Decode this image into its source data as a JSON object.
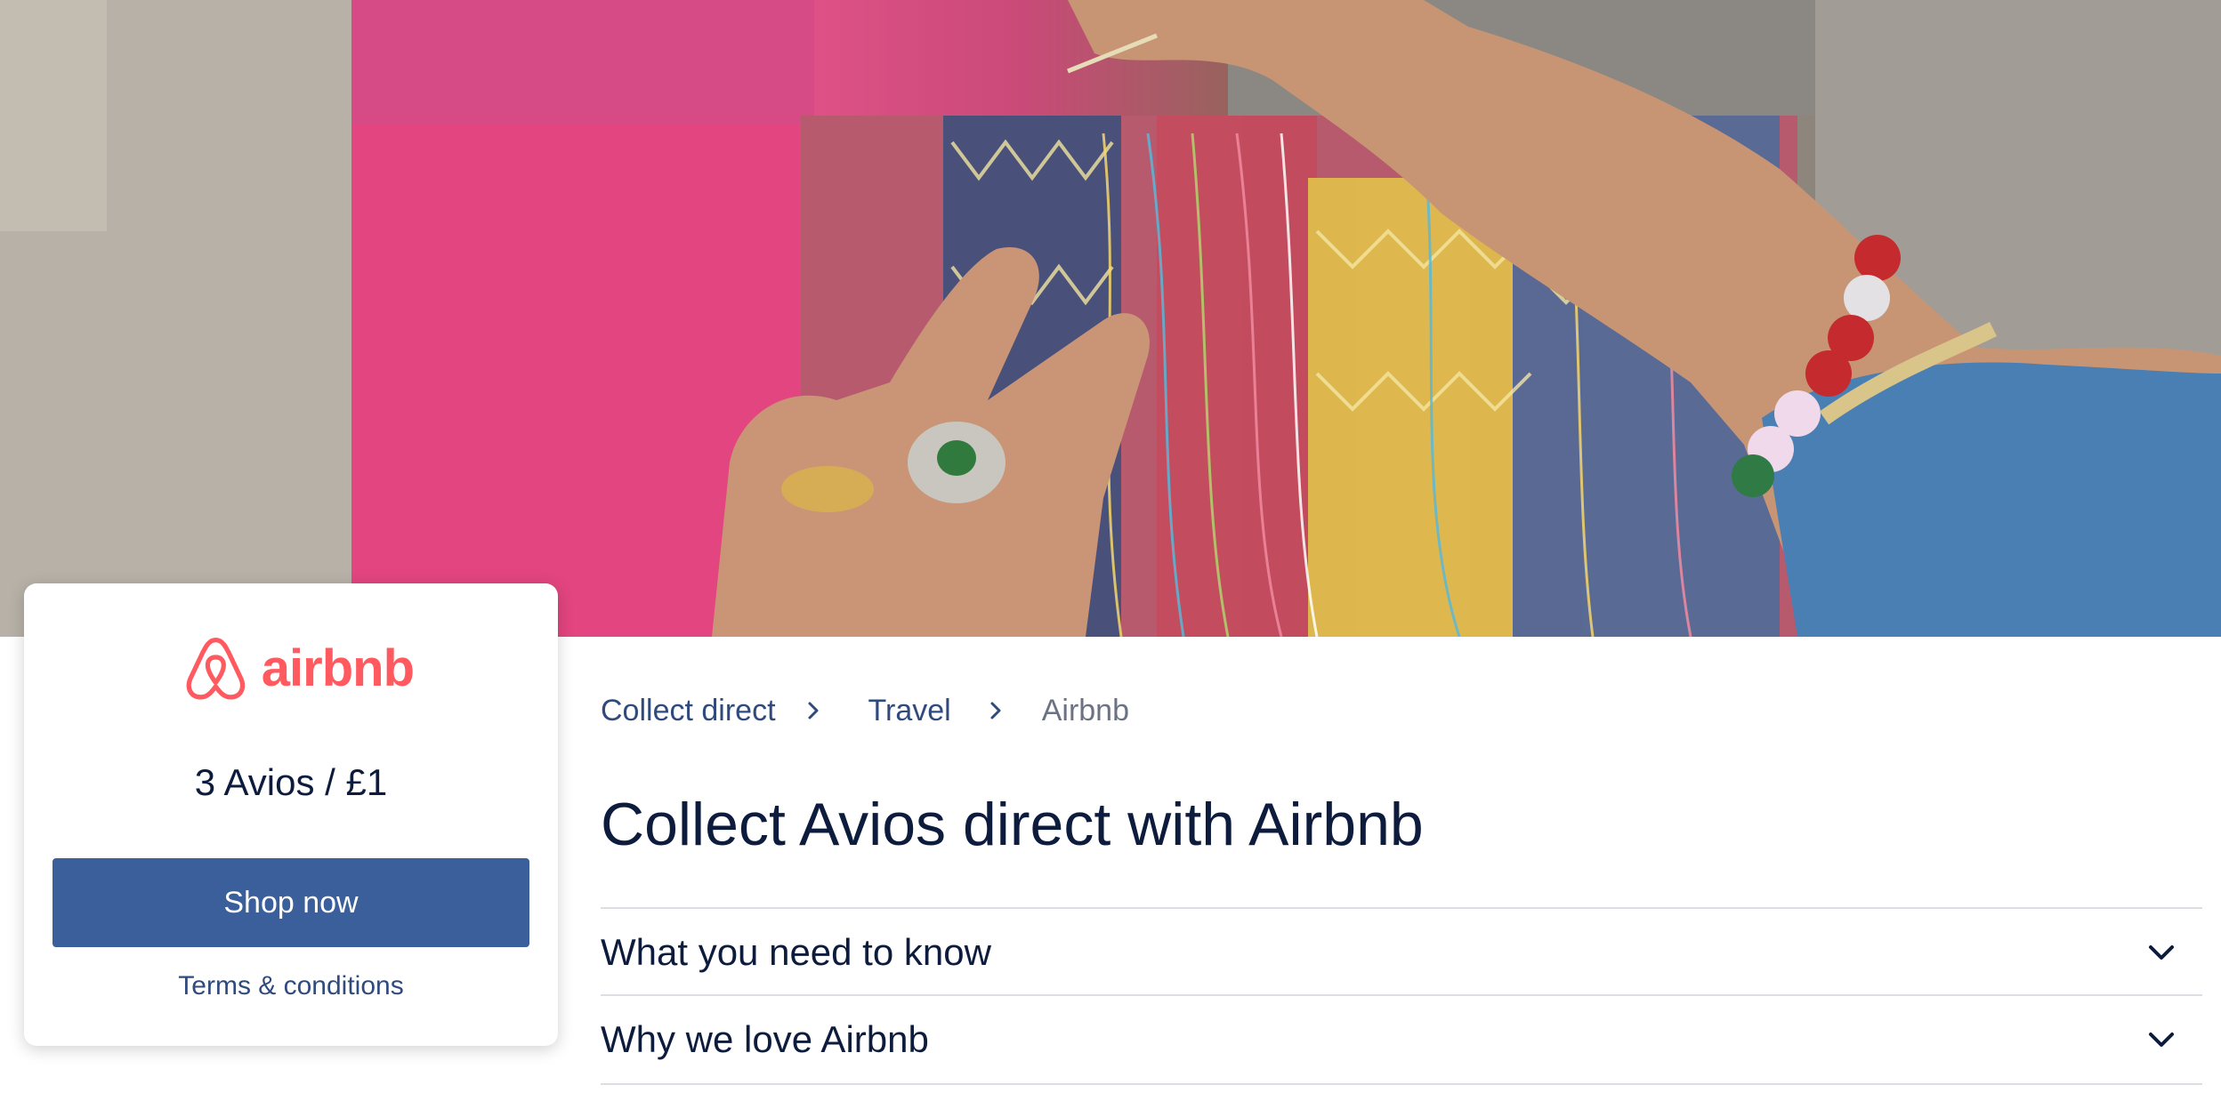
{
  "card": {
    "brand_name": "airbnb",
    "rate": "3 Avios / £1",
    "shop_label": "Shop now",
    "terms_label": "Terms & conditions",
    "brand_color": "#ff5a5f",
    "button_color": "#3a5f9a"
  },
  "breadcrumb": {
    "items": [
      "Collect direct",
      "Travel",
      "Airbnb"
    ]
  },
  "page": {
    "title": "Collect Avios direct with Airbnb"
  },
  "accordion": {
    "items": [
      "What you need to know",
      "Why we love Airbnb"
    ]
  },
  "icons": {
    "breadcrumb_separator": "chevron-right-icon",
    "accordion_toggle": "chevron-down-icon",
    "logo": "airbnb-belo-icon"
  }
}
